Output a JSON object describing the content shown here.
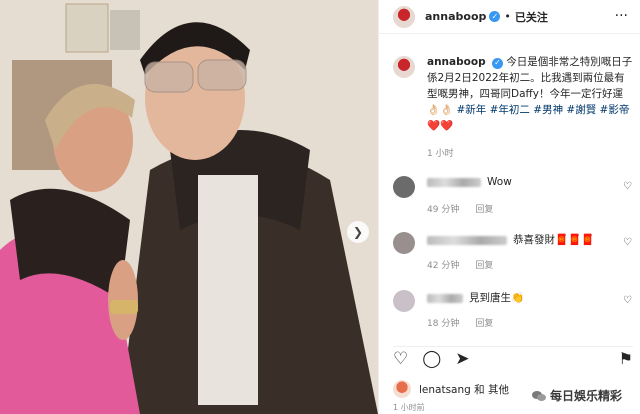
{
  "post": {
    "username": "annaboop",
    "verified_icon": "check-icon",
    "separator": "•",
    "follow_status": "已关注",
    "more_icon": "ellipsis-icon"
  },
  "caption": {
    "username": "annaboop",
    "text": "今日是個非常之特別嘅日子係2月2日2022年初二。比我遇到兩位最有型嘅男神，四哥同Daffy！今年一定行好運",
    "emoji": "👌🏻👌🏻",
    "tags": "#新年 #年初二 #男神 #謝賢 #影帝",
    "hearts": "❤️❤️",
    "time": "1 小时"
  },
  "comments": [
    {
      "text": "Wow",
      "time": "49 分钟",
      "reply": "回复",
      "avatar_color": "#d9d9d9"
    },
    {
      "text": "恭喜發財🧧🧧🧧",
      "time": "42 分钟",
      "reply": "回复",
      "avatar_color": "#b6c6d8"
    },
    {
      "text": "見到唐生👏",
      "time": "18 分钟",
      "reply": "回复",
      "avatar_color": "#c9c0c8"
    }
  ],
  "likes": {
    "text": "lenatsang 和 其他",
    "ago": "1 小时前"
  },
  "watermark": {
    "text": "每日娛乐精彩"
  },
  "colors": {
    "link": "#00376b",
    "verified": "#3897f0",
    "heart": "#ed4956"
  }
}
